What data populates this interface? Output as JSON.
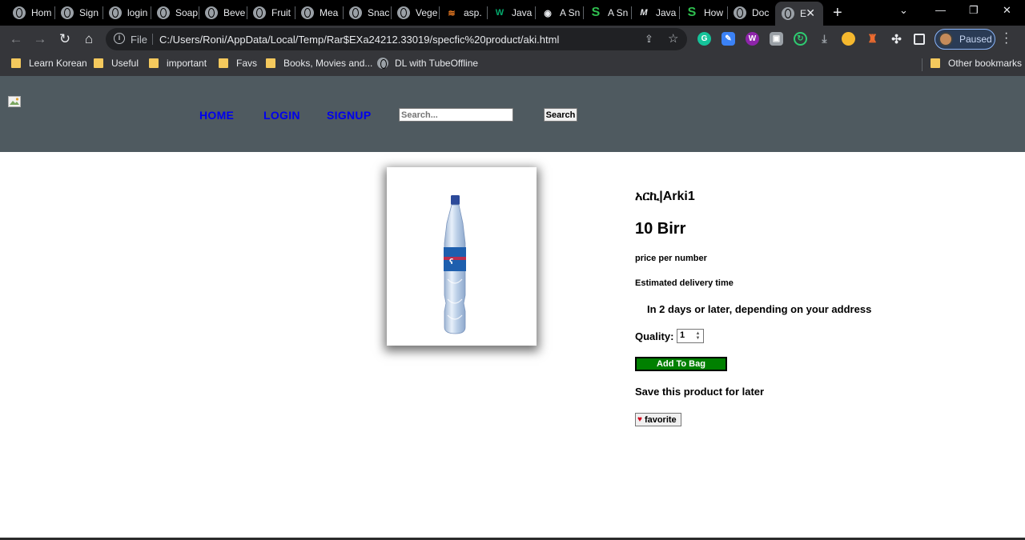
{
  "browser": {
    "tabs": [
      {
        "label": "Hom",
        "icon": "globe-icon"
      },
      {
        "label": "Sign",
        "icon": "globe-icon"
      },
      {
        "label": "login",
        "icon": "globe-icon"
      },
      {
        "label": "Soap",
        "icon": "globe-icon"
      },
      {
        "label": "Beve",
        "icon": "globe-icon"
      },
      {
        "label": "Fruit",
        "icon": "globe-icon"
      },
      {
        "label": "Mea",
        "icon": "globe-icon"
      },
      {
        "label": "Snac",
        "icon": "globe-icon"
      },
      {
        "label": "Vege",
        "icon": "globe-icon"
      },
      {
        "label": "asp.",
        "icon": "stackoverflow-icon"
      },
      {
        "label": "Java",
        "icon": "w3schools-icon"
      },
      {
        "label": "A Sn",
        "icon": "github-icon"
      },
      {
        "label": "A Sn",
        "icon": "s-logo-icon"
      },
      {
        "label": "Java",
        "icon": "medium-icon"
      },
      {
        "label": "How",
        "icon": "s-logo-icon"
      },
      {
        "label": "Doc",
        "icon": "globe-icon"
      },
      {
        "label": "E",
        "icon": "globe-icon"
      }
    ],
    "address": {
      "scheme_label": "File",
      "url": "C:/Users/Roni/AppData/Local/Temp/Rar$EXa24212.33019/specfic%20product/aki.html"
    },
    "profile_label": "Paused",
    "bookmarks": [
      "Learn Korean",
      "Useful",
      "important",
      "Favs",
      "Books, Movies and...",
      "DL with TubeOffline"
    ],
    "other_bookmarks": "Other bookmarks"
  },
  "site": {
    "nav": {
      "home": "HOME",
      "login": "LOGIN",
      "signup": "SIGNUP"
    },
    "search": {
      "placeholder": "Search...",
      "button": "Search"
    }
  },
  "product": {
    "title": "አርኪ|Arki1",
    "price": "10 Birr",
    "unit": "price per number",
    "delivery_label": "Estimated delivery time",
    "delivery_value": "In 2 days or later, depending on your address",
    "quantity_label": "Quality:",
    "quantity_value": "1",
    "add_button": "Add To Bag",
    "save_text": "Save this product for later",
    "favorite_button": "favorite"
  },
  "colors": {
    "header_bg": "#4f5a60",
    "nav_link": "#0000ee",
    "add_button_bg": "#008000"
  }
}
